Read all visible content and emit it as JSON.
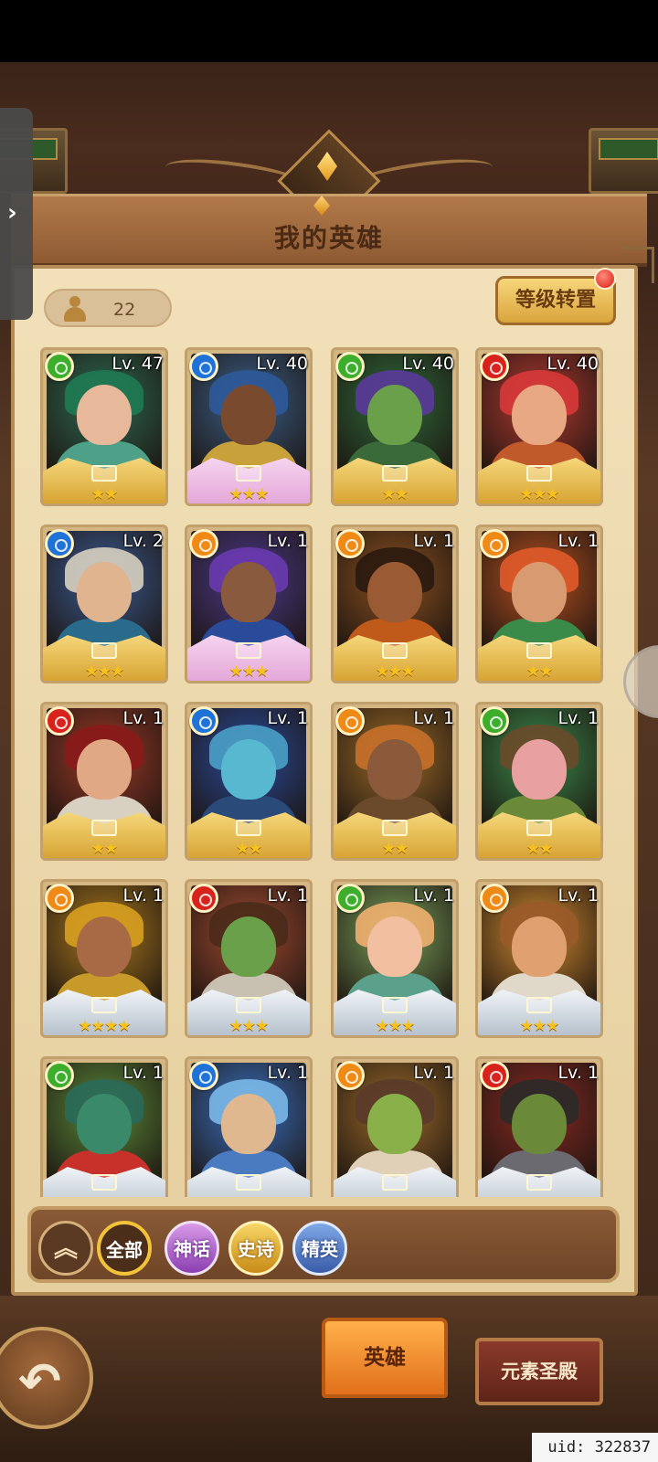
{
  "header": {
    "title": "我的英雄"
  },
  "hero_count": "22",
  "reset_button": "等级转置",
  "heroes": [
    {
      "level": "Lv. 47",
      "element": "nature",
      "stars": "★★",
      "rarity": "gold",
      "hair": "#1f7a52",
      "face": "#e8b89a",
      "body": "#4fa089",
      "bg": "#2d6a52"
    },
    {
      "level": "Lv. 40",
      "element": "water",
      "stars": "★★★",
      "rarity": "mythic",
      "hair": "#2e5a9a",
      "face": "#7a4a2e",
      "body": "#c8a13a",
      "bg": "#3a5f88"
    },
    {
      "level": "Lv. 40",
      "element": "nature",
      "stars": "★★",
      "rarity": "gold",
      "hair": "#5a3a9a",
      "face": "#6aa04a",
      "body": "#3a6a3a",
      "bg": "#2e6a3a"
    },
    {
      "level": "Lv. 40",
      "element": "fire",
      "stars": "★★★",
      "rarity": "gold",
      "hair": "#d8383a",
      "face": "#e8a884",
      "body": "#c05a2a",
      "bg": "#b03a30"
    },
    {
      "level": "Lv. 2",
      "element": "water",
      "stars": "★★★",
      "rarity": "gold",
      "hair": "#d8d0c0",
      "face": "#e0b48e",
      "body": "#2a6a8a",
      "bg": "#3a5a90"
    },
    {
      "level": "Lv. 1",
      "element": "light",
      "stars": "★★★",
      "rarity": "mythic",
      "hair": "#6a3ab0",
      "face": "#8a5a3e",
      "body": "#2a4a9a",
      "bg": "#4a3a8a"
    },
    {
      "level": "Lv. 1",
      "element": "light",
      "stars": "★★★",
      "rarity": "gold",
      "hair": "#2a1a10",
      "face": "#9a5a34",
      "body": "#c05a1a",
      "bg": "#8a5020"
    },
    {
      "level": "Lv. 1",
      "element": "light",
      "stars": "★★",
      "rarity": "gold",
      "hair": "#e05a2a",
      "face": "#d89a70",
      "body": "#3a8a4a",
      "bg": "#b45020"
    },
    {
      "level": "Lv. 1",
      "element": "fire",
      "stars": "★★",
      "rarity": "gold",
      "hair": "#8a1a1a",
      "face": "#e0a884",
      "body": "#d8d0c0",
      "bg": "#9a3a28"
    },
    {
      "level": "Lv. 1",
      "element": "water",
      "stars": "★★",
      "rarity": "gold",
      "hair": "#4aa0c8",
      "face": "#58b8d0",
      "body": "#2a4a7a",
      "bg": "#2a4a9a"
    },
    {
      "level": "Lv. 1",
      "element": "light",
      "stars": "★★",
      "rarity": "gold",
      "hair": "#c8702a",
      "face": "#8a5a3a",
      "body": "#6a4a2a",
      "bg": "#9a6a28"
    },
    {
      "level": "Lv. 1",
      "element": "nature",
      "stars": "★★",
      "rarity": "gold",
      "hair": "#6a4a2a",
      "face": "#e8a0a0",
      "body": "#6a8a3a",
      "bg": "#3a8a4a"
    },
    {
      "level": "Lv. 1",
      "element": "light",
      "stars": "★★★★",
      "rarity": "silver",
      "hair": "#d8a020",
      "face": "#a86a44",
      "body": "#c89a2a",
      "bg": "#a8781e"
    },
    {
      "level": "Lv. 1",
      "element": "fire",
      "stars": "★★★",
      "rarity": "silver",
      "hair": "#4a2a1a",
      "face": "#6aa04a",
      "body": "#c8c0b0",
      "bg": "#a04a30"
    },
    {
      "level": "Lv. 1",
      "element": "nature",
      "stars": "★★★",
      "rarity": "silver",
      "hair": "#f0b070",
      "face": "#f2c0a0",
      "body": "#5aa08a",
      "bg": "#7aa05a"
    },
    {
      "level": "Lv. 1",
      "element": "light",
      "stars": "★★★",
      "rarity": "silver",
      "hair": "#9a5a2a",
      "face": "#e0a070",
      "body": "#e0d8c8",
      "bg": "#d08a30"
    },
    {
      "level": "Lv. 1",
      "element": "nature",
      "stars": "",
      "rarity": "silver",
      "hair": "#2a6a5a",
      "face": "#3a8a6a",
      "body": "#c8302a",
      "bg": "#5a8a3a"
    },
    {
      "level": "Lv. 1",
      "element": "water",
      "stars": "",
      "rarity": "silver",
      "hair": "#7ab8e8",
      "face": "#e0b890",
      "body": "#4a7ac0",
      "bg": "#3a70c0"
    },
    {
      "level": "Lv. 1",
      "element": "light",
      "stars": "",
      "rarity": "silver",
      "hair": "#5a3a2a",
      "face": "#8ab04a",
      "body": "#e0d0b8",
      "bg": "#9a6a2a"
    },
    {
      "level": "Lv. 1",
      "element": "fire",
      "stars": "",
      "rarity": "silver",
      "hair": "#2a2a2a",
      "face": "#6a8a3a",
      "body": "#6a6a70",
      "bg": "#8a2a22"
    }
  ],
  "element_colors": {
    "nature": "#3cae2c",
    "water": "#1f72d8",
    "fire": "#d8221c",
    "light": "#ef8a16"
  },
  "filters": {
    "all": "全部",
    "mythic": "神话",
    "epic": "史诗",
    "elite": "精英"
  },
  "tabs": {
    "heroes": "英雄",
    "temple": "元素圣殿"
  },
  "uid": "uid: 322837"
}
